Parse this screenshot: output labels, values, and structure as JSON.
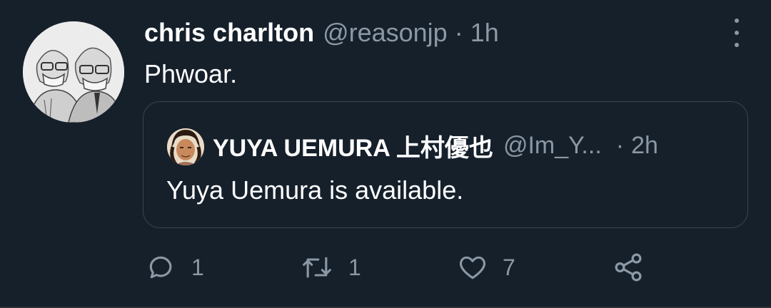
{
  "tweet": {
    "author_name": "chris charlton",
    "author_handle": "@reasonjp",
    "separator": "·",
    "time": "1h",
    "text": "Phwoar."
  },
  "quote": {
    "author_name": "YUYA UEMURA 上村優也",
    "author_handle": "@Im_Y...",
    "separator": "·",
    "time": "2h",
    "text": "Yuya Uemura is available."
  },
  "actions": {
    "reply_count": "1",
    "retweet_count": "1",
    "like_count": "7"
  },
  "icons": {
    "reply": "reply-icon",
    "retweet": "retweet-icon",
    "like": "heart-icon",
    "share": "share-icon",
    "more": "more-vertical-icon"
  },
  "colors": {
    "background": "#15202b",
    "secondary_text": "#8b98a5",
    "border": "#38444d"
  }
}
